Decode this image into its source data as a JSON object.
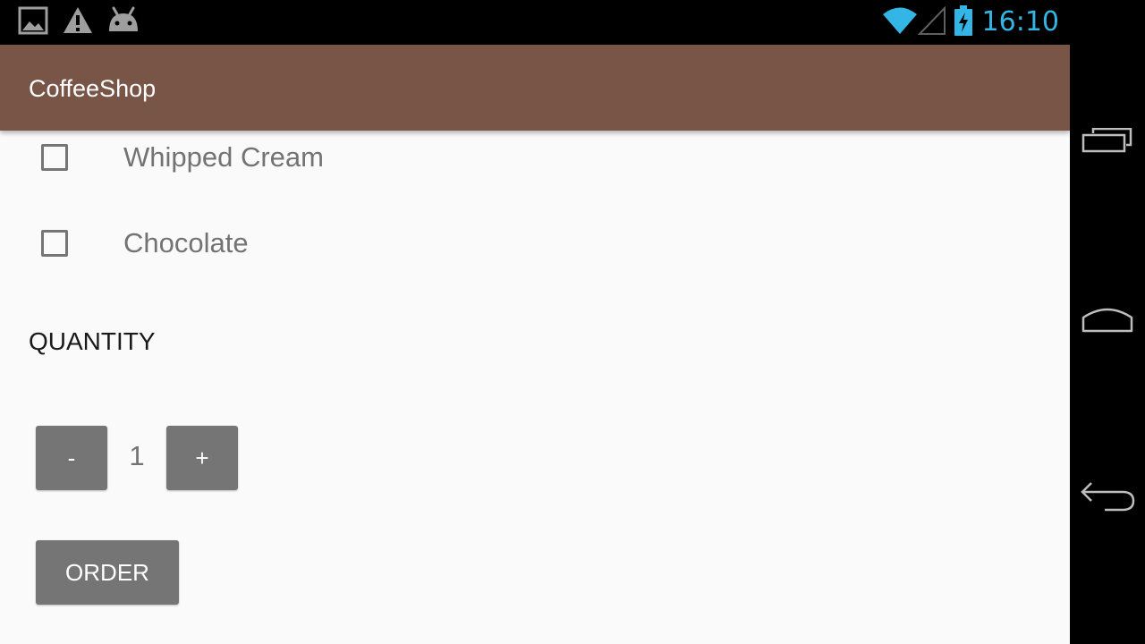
{
  "status_bar": {
    "notification_icons": [
      "image-icon",
      "warning-icon",
      "android-icon"
    ],
    "system_icons": [
      "wifi-icon",
      "cellular-signal-icon",
      "battery-charging-icon"
    ],
    "time": "16:10",
    "time_color": "#33b5e5"
  },
  "app_bar": {
    "title": "CoffeeShop",
    "color": "#795548"
  },
  "toppings": [
    {
      "label": "Whipped Cream",
      "checked": false
    },
    {
      "label": "Chocolate",
      "checked": false
    }
  ],
  "quantity": {
    "header": "QUANTITY",
    "decrement_label": "-",
    "value": "1",
    "increment_label": "+"
  },
  "order": {
    "label": "ORDER"
  },
  "nav_bar": {
    "buttons": [
      "recent-apps-icon",
      "home-icon",
      "back-icon"
    ]
  }
}
